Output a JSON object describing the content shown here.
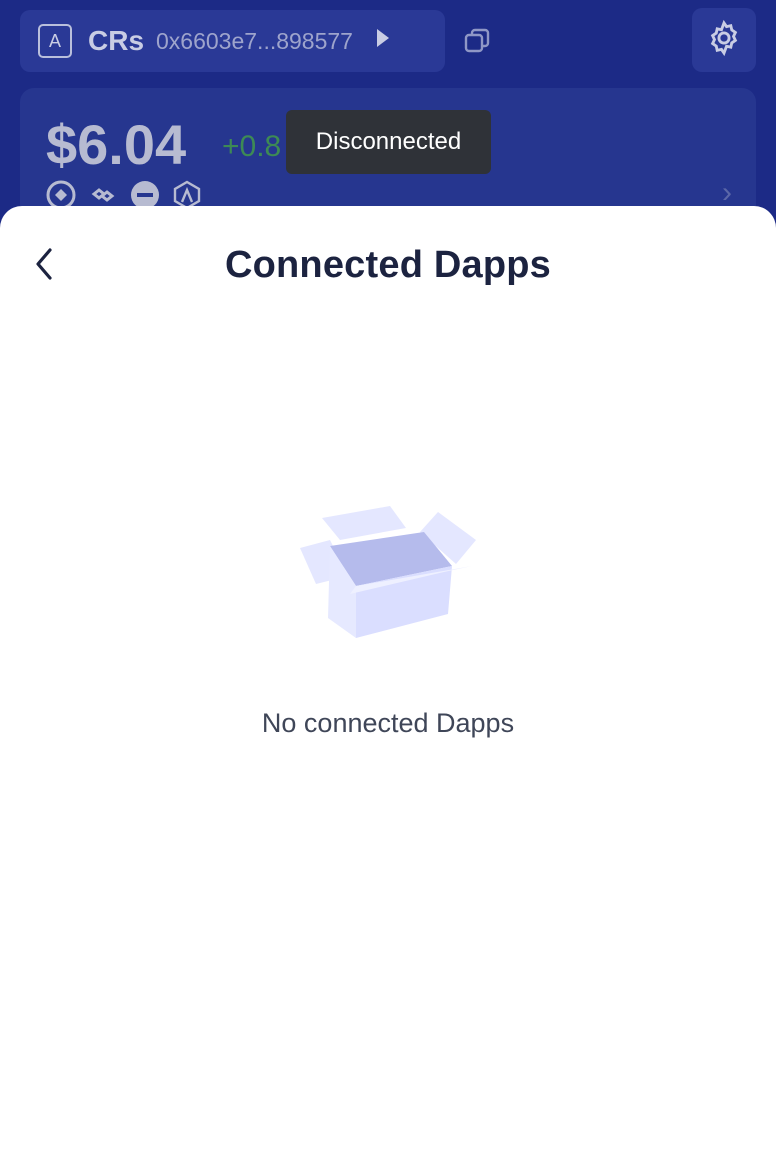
{
  "header": {
    "account_letter": "A",
    "account_name": "CRs",
    "account_address": "0x6603e7...898577",
    "play_icon": "play-arrow-icon",
    "copy_icon": "copy-icon",
    "settings_icon": "gear-icon"
  },
  "balance": {
    "amount": "$6.04",
    "change": "+0.8",
    "chains": [
      "chain-icon-1",
      "chain-icon-2",
      "chain-icon-3",
      "chain-icon-4"
    ],
    "chevron": "›"
  },
  "toast": {
    "message": "Disconnected"
  },
  "sheet": {
    "title": "Connected Dapps",
    "back_icon": "chevron-left-icon",
    "empty_message": "No connected Dapps"
  },
  "colors": {
    "header_bg": "#1c2a86",
    "sheet_bg": "#ffffff",
    "title_color": "#1c2340",
    "toast_bg": "#2f3238",
    "positive": "#3d8a55"
  }
}
